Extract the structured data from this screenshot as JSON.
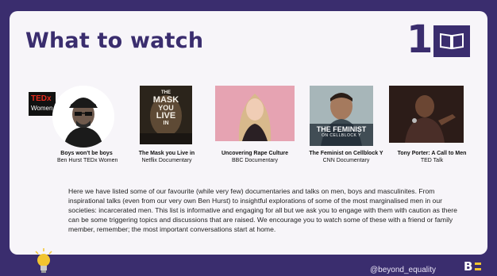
{
  "slide": {
    "title": "What to watch",
    "number": "1",
    "tedx": {
      "line1": "TEDx",
      "line2": "Women"
    },
    "items": [
      {
        "title": "Boys won't be boys",
        "subtitle": "Ben Hurst TEDx Women"
      },
      {
        "title": "The Mask you Live in",
        "subtitle": "Netflix Documentary",
        "poster_text": [
          "THE",
          "MASK",
          "YOU",
          "LIVE",
          "IN"
        ]
      },
      {
        "title": "Uncovering Rape Culture",
        "subtitle": "BBC Documentary"
      },
      {
        "title": "The Feminist on Cellblock Y",
        "subtitle": "CNN Documentary",
        "poster_text": [
          "THE FEMINIST",
          "ON CELLBLOCK Y"
        ]
      },
      {
        "title": "Tony Porter: A Call to Men",
        "subtitle": "TED Talk"
      }
    ],
    "description": "Here we have listed some of our favourite (while very few) documentaries and talks on men, boys and masculinites. From inspirational talks (even from our very own Ben Hurst) to insightful explorations of some of the most marginalised men in our societies: incarcerated men. This list is informative and engaging for all but we ask you to engage with them with caution as there can be some triggering topics and discussions that are raised. We encourage you to watch some of these with a friend or family member, remember; the most important conversations start at home.",
    "handle": "@beyond_equality",
    "logo_letter": "B"
  },
  "colors": {
    "brand": "#3a2d6e",
    "accent": "#f2c530",
    "ted_red": "#e62b1e",
    "card": "#f7f5f9"
  },
  "icons": [
    "book-icon",
    "lightbulb-icon",
    "beyond-equality-logo"
  ]
}
